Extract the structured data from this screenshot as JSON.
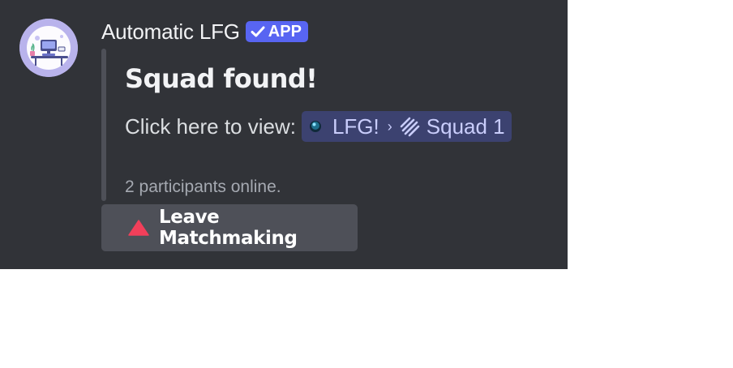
{
  "message": {
    "author": "Automatic LFG",
    "app_tag": "APP",
    "embed": {
      "title": "Squad found!",
      "description_prefix": "Click here to view:",
      "channel_mention": {
        "parent": "LFG!",
        "thread": "Squad 1"
      },
      "footer": "2 participants online."
    },
    "button": {
      "label": "Leave Matchmaking"
    }
  },
  "colors": {
    "background": "#313338",
    "accent": "#5865f2",
    "mention_bg": "#3c4270",
    "button_bg": "#4e5058",
    "warning": "#f23f5a"
  },
  "icons": {
    "app_tag": "check-icon",
    "mention_parent": "orb-icon",
    "separator": "chevron-right-icon",
    "mention_thread": "thread-icon",
    "button": "warning-triangle-icon"
  }
}
